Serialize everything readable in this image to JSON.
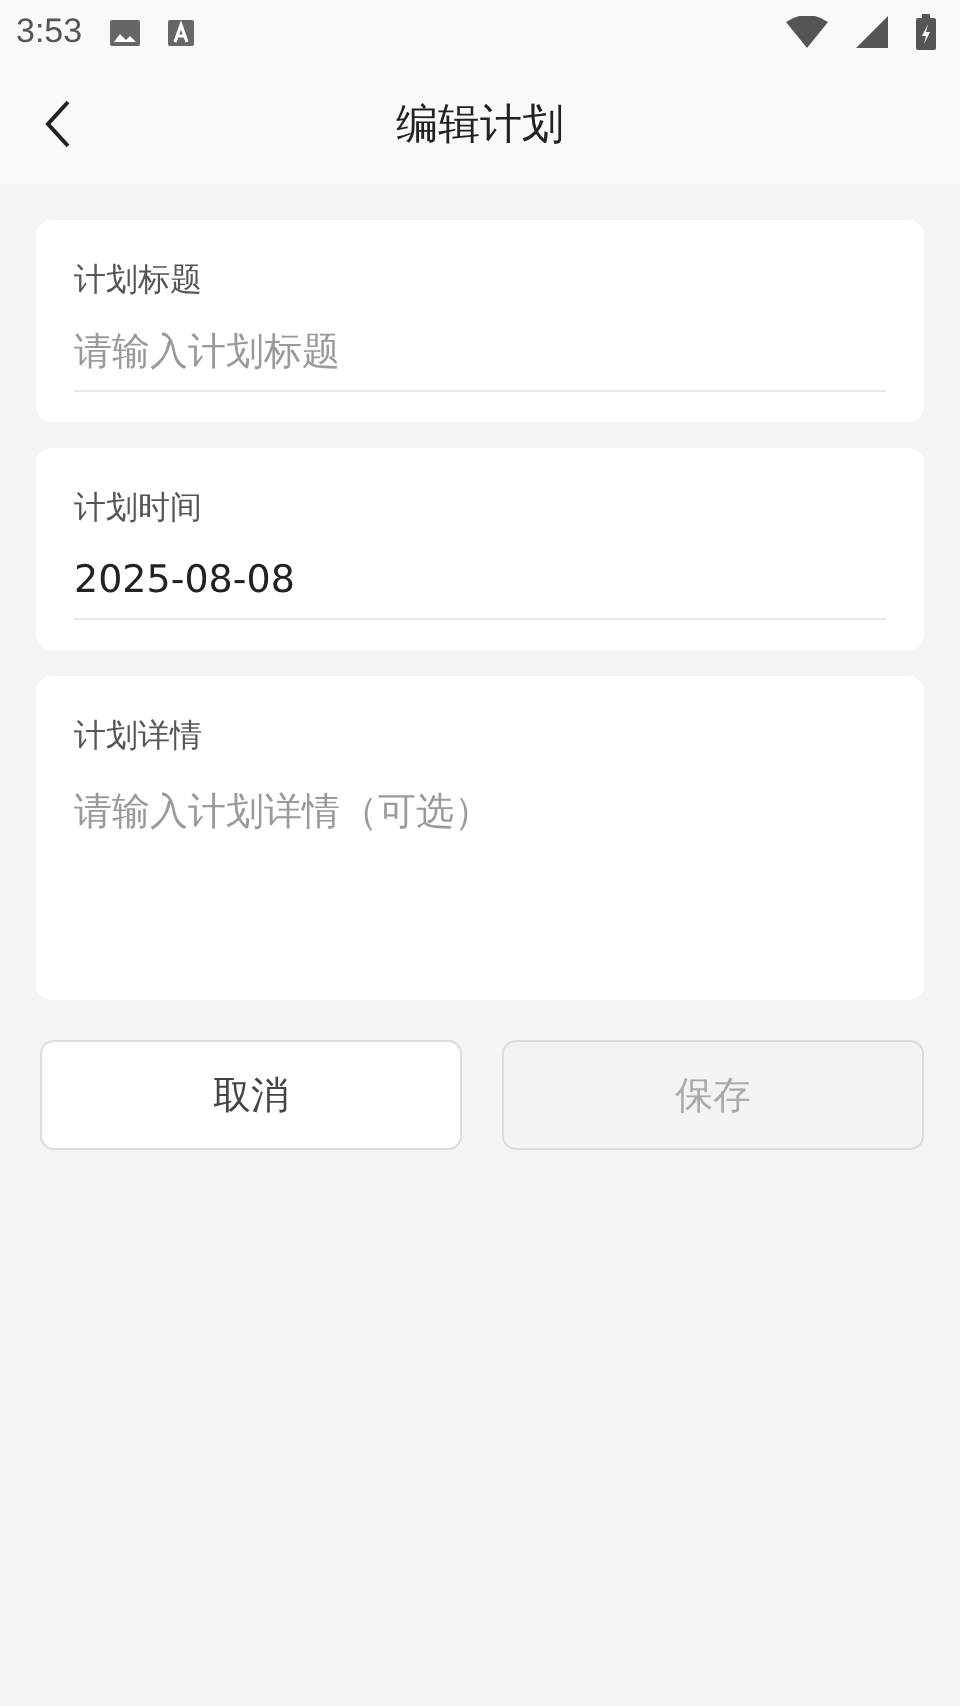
{
  "status_bar": {
    "time": "3:53"
  },
  "header": {
    "title": "编辑计划"
  },
  "fields": [
    {
      "kind": "line",
      "label": "计划标题",
      "placeholder": "请输入计划标题"
    },
    {
      "kind": "line",
      "label": "计划时间",
      "value": "2025-08-08"
    },
    {
      "kind": "area",
      "label": "计划详情",
      "placeholder": "请输入计划详情（可选）"
    }
  ],
  "buttons": [
    {
      "label": "取消",
      "disabled": false
    },
    {
      "label": "保存",
      "disabled": true
    }
  ]
}
